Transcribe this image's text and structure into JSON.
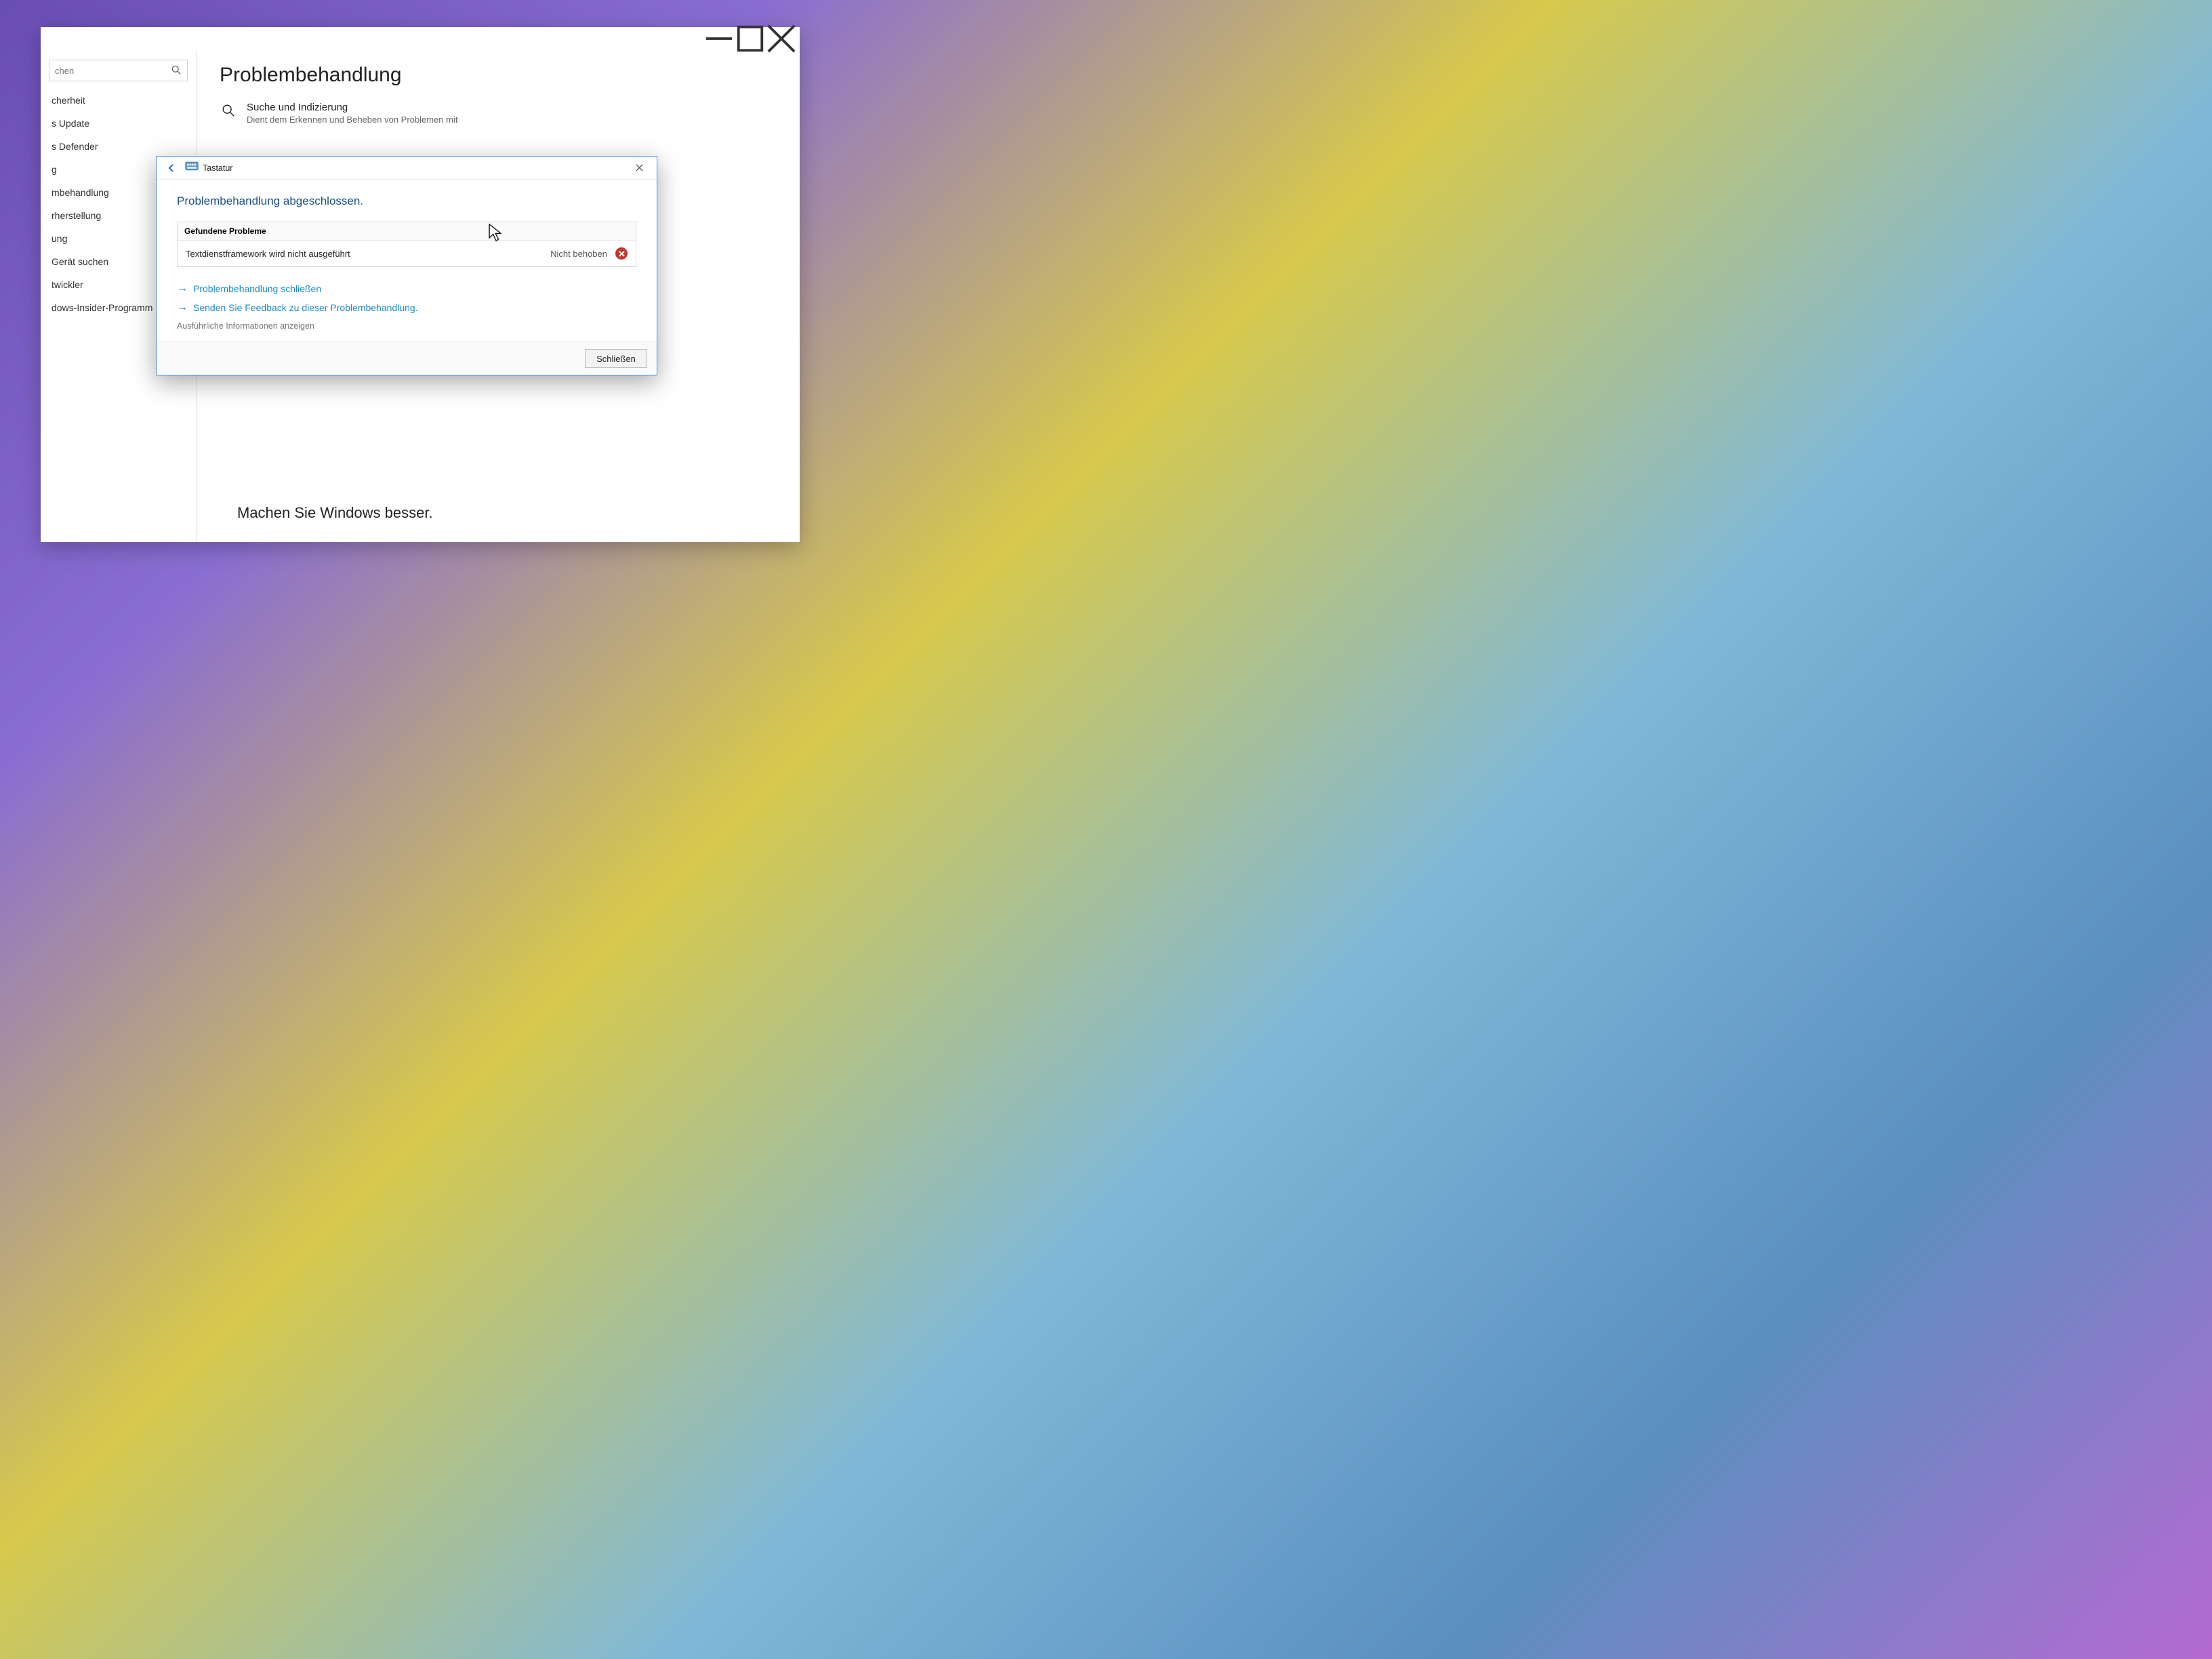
{
  "settings": {
    "search_placeholder": "chen",
    "page_title": "Problembehandlung",
    "option": {
      "title": "Suche und Indizierung",
      "desc": "Dient dem Erkennen und Beheben von Problemen mit"
    },
    "sidebar": [
      "cherheit",
      "s Update",
      "s Defender",
      "g",
      "mbehandlung",
      "rherstellung",
      "ung",
      "Gerät suchen",
      "twickler",
      "dows-Insider-Programm"
    ],
    "footer_cta": "Machen Sie Windows besser."
  },
  "dialog": {
    "title": "Tastatur",
    "heading": "Problembehandlung abgeschlossen.",
    "found_header": "Gefundene Probleme",
    "problem_name": "Textdienstframework wird nicht ausgeführt",
    "problem_status": "Nicht behoben",
    "link_close": "Problembehandlung schließen",
    "link_feedback": "Senden Sie Feedback zu dieser Problembehandlung.",
    "link_details": "Ausführliche Informationen anzeigen",
    "btn_close": "Schließen"
  }
}
